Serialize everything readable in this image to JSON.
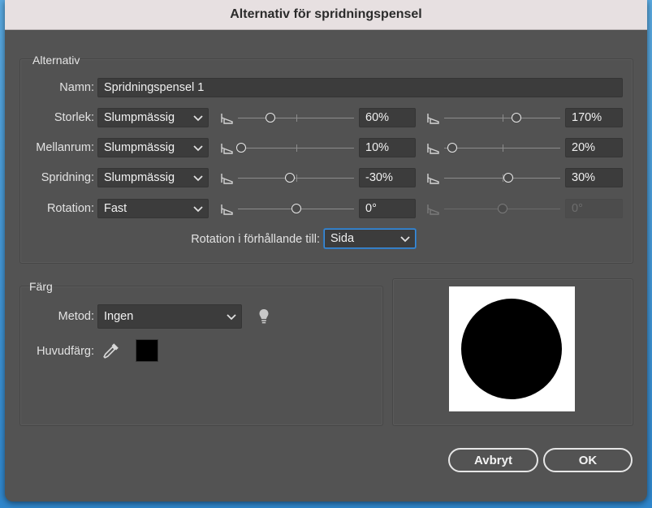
{
  "window": {
    "title": "Alternativ för spridningspensel"
  },
  "options_group": {
    "title": "Alternativ",
    "name_label": "Namn:",
    "name_value": "Spridningspensel 1",
    "rows": [
      {
        "label": "Storlek:",
        "mode": "Slumpmässig",
        "min_value": "60%",
        "max_value": "170%",
        "min_frac": 0.28,
        "max_frac": 0.62,
        "max_disabled": false
      },
      {
        "label": "Mellanrum:",
        "mode": "Slumpmässig",
        "min_value": "10%",
        "max_value": "20%",
        "min_frac": 0.03,
        "max_frac": 0.07,
        "max_disabled": false
      },
      {
        "label": "Spridning:",
        "mode": "Slumpmässig",
        "min_value": "-30%",
        "max_value": "30%",
        "min_frac": 0.45,
        "max_frac": 0.55,
        "max_disabled": false
      },
      {
        "label": "Rotation:",
        "mode": "Fast",
        "min_value": "0°",
        "max_value": "0°",
        "min_frac": 0.5,
        "max_frac": 0.5,
        "max_disabled": true
      }
    ],
    "rotation_relative_label": "Rotation i förhållande till:",
    "rotation_relative_value": "Sida"
  },
  "color_group": {
    "title": "Färg",
    "method_label": "Metod:",
    "method_value": "Ingen",
    "key_color_label": "Huvudfärg:",
    "key_color": "#000000"
  },
  "icons": {
    "dropdown": "chevron-down-icon",
    "slider": "slider-icon",
    "tips": "lightbulb-icon",
    "eyedropper": "eyedropper-icon"
  },
  "buttons": {
    "cancel": "Avbryt",
    "ok": "OK"
  }
}
